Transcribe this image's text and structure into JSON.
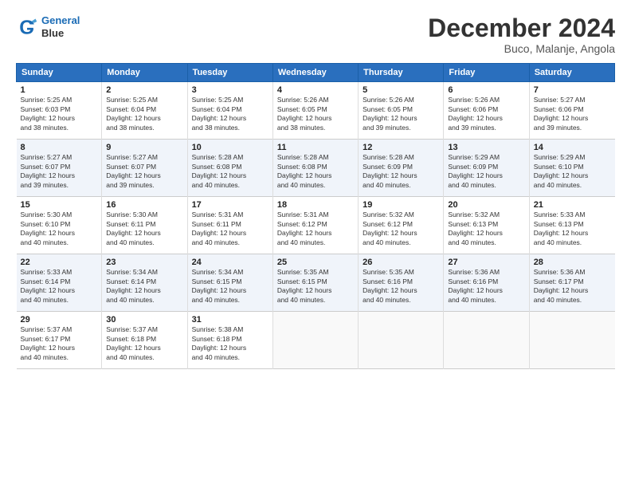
{
  "logo": {
    "line1": "General",
    "line2": "Blue"
  },
  "title": "December 2024",
  "subtitle": "Buco, Malanje, Angola",
  "header_days": [
    "Sunday",
    "Monday",
    "Tuesday",
    "Wednesday",
    "Thursday",
    "Friday",
    "Saturday"
  ],
  "weeks": [
    [
      {
        "day": "1",
        "info": "Sunrise: 5:25 AM\nSunset: 6:03 PM\nDaylight: 12 hours\nand 38 minutes."
      },
      {
        "day": "2",
        "info": "Sunrise: 5:25 AM\nSunset: 6:04 PM\nDaylight: 12 hours\nand 38 minutes."
      },
      {
        "day": "3",
        "info": "Sunrise: 5:25 AM\nSunset: 6:04 PM\nDaylight: 12 hours\nand 38 minutes."
      },
      {
        "day": "4",
        "info": "Sunrise: 5:26 AM\nSunset: 6:05 PM\nDaylight: 12 hours\nand 38 minutes."
      },
      {
        "day": "5",
        "info": "Sunrise: 5:26 AM\nSunset: 6:05 PM\nDaylight: 12 hours\nand 39 minutes."
      },
      {
        "day": "6",
        "info": "Sunrise: 5:26 AM\nSunset: 6:06 PM\nDaylight: 12 hours\nand 39 minutes."
      },
      {
        "day": "7",
        "info": "Sunrise: 5:27 AM\nSunset: 6:06 PM\nDaylight: 12 hours\nand 39 minutes."
      }
    ],
    [
      {
        "day": "8",
        "info": "Sunrise: 5:27 AM\nSunset: 6:07 PM\nDaylight: 12 hours\nand 39 minutes."
      },
      {
        "day": "9",
        "info": "Sunrise: 5:27 AM\nSunset: 6:07 PM\nDaylight: 12 hours\nand 39 minutes."
      },
      {
        "day": "10",
        "info": "Sunrise: 5:28 AM\nSunset: 6:08 PM\nDaylight: 12 hours\nand 40 minutes."
      },
      {
        "day": "11",
        "info": "Sunrise: 5:28 AM\nSunset: 6:08 PM\nDaylight: 12 hours\nand 40 minutes."
      },
      {
        "day": "12",
        "info": "Sunrise: 5:28 AM\nSunset: 6:09 PM\nDaylight: 12 hours\nand 40 minutes."
      },
      {
        "day": "13",
        "info": "Sunrise: 5:29 AM\nSunset: 6:09 PM\nDaylight: 12 hours\nand 40 minutes."
      },
      {
        "day": "14",
        "info": "Sunrise: 5:29 AM\nSunset: 6:10 PM\nDaylight: 12 hours\nand 40 minutes."
      }
    ],
    [
      {
        "day": "15",
        "info": "Sunrise: 5:30 AM\nSunset: 6:10 PM\nDaylight: 12 hours\nand 40 minutes."
      },
      {
        "day": "16",
        "info": "Sunrise: 5:30 AM\nSunset: 6:11 PM\nDaylight: 12 hours\nand 40 minutes."
      },
      {
        "day": "17",
        "info": "Sunrise: 5:31 AM\nSunset: 6:11 PM\nDaylight: 12 hours\nand 40 minutes."
      },
      {
        "day": "18",
        "info": "Sunrise: 5:31 AM\nSunset: 6:12 PM\nDaylight: 12 hours\nand 40 minutes."
      },
      {
        "day": "19",
        "info": "Sunrise: 5:32 AM\nSunset: 6:12 PM\nDaylight: 12 hours\nand 40 minutes."
      },
      {
        "day": "20",
        "info": "Sunrise: 5:32 AM\nSunset: 6:13 PM\nDaylight: 12 hours\nand 40 minutes."
      },
      {
        "day": "21",
        "info": "Sunrise: 5:33 AM\nSunset: 6:13 PM\nDaylight: 12 hours\nand 40 minutes."
      }
    ],
    [
      {
        "day": "22",
        "info": "Sunrise: 5:33 AM\nSunset: 6:14 PM\nDaylight: 12 hours\nand 40 minutes."
      },
      {
        "day": "23",
        "info": "Sunrise: 5:34 AM\nSunset: 6:14 PM\nDaylight: 12 hours\nand 40 minutes."
      },
      {
        "day": "24",
        "info": "Sunrise: 5:34 AM\nSunset: 6:15 PM\nDaylight: 12 hours\nand 40 minutes."
      },
      {
        "day": "25",
        "info": "Sunrise: 5:35 AM\nSunset: 6:15 PM\nDaylight: 12 hours\nand 40 minutes."
      },
      {
        "day": "26",
        "info": "Sunrise: 5:35 AM\nSunset: 6:16 PM\nDaylight: 12 hours\nand 40 minutes."
      },
      {
        "day": "27",
        "info": "Sunrise: 5:36 AM\nSunset: 6:16 PM\nDaylight: 12 hours\nand 40 minutes."
      },
      {
        "day": "28",
        "info": "Sunrise: 5:36 AM\nSunset: 6:17 PM\nDaylight: 12 hours\nand 40 minutes."
      }
    ],
    [
      {
        "day": "29",
        "info": "Sunrise: 5:37 AM\nSunset: 6:17 PM\nDaylight: 12 hours\nand 40 minutes."
      },
      {
        "day": "30",
        "info": "Sunrise: 5:37 AM\nSunset: 6:18 PM\nDaylight: 12 hours\nand 40 minutes."
      },
      {
        "day": "31",
        "info": "Sunrise: 5:38 AM\nSunset: 6:18 PM\nDaylight: 12 hours\nand 40 minutes."
      },
      {
        "day": "",
        "info": ""
      },
      {
        "day": "",
        "info": ""
      },
      {
        "day": "",
        "info": ""
      },
      {
        "day": "",
        "info": ""
      }
    ]
  ]
}
